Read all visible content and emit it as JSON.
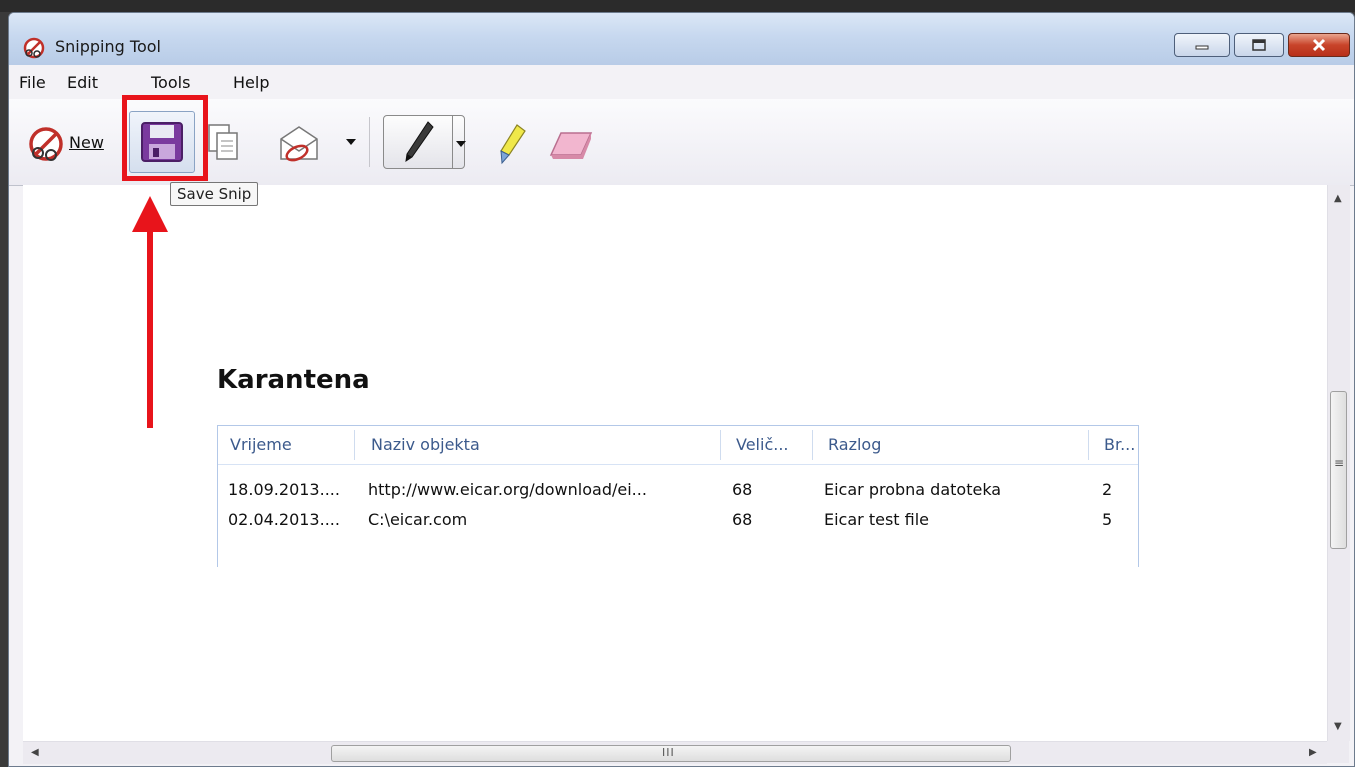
{
  "window": {
    "title": "Snipping Tool",
    "icon": "snipping-tool-scissors-icon"
  },
  "menu": [
    "File",
    "Edit",
    "Tools",
    "Help"
  ],
  "toolbar": {
    "new_label": "New",
    "icons": [
      "new-snip-icon",
      "save-snip-icon",
      "copy-icon",
      "send-snip-icon",
      "pen-icon",
      "highlighter-icon",
      "eraser-icon"
    ]
  },
  "tooltip": "Save Snip",
  "annotation": {
    "highlight_color": "#e8141b",
    "arrow_color": "#e8141b"
  },
  "snip": {
    "heading": "Karantena",
    "columns": [
      "Vrijeme",
      "Naziv objekta",
      "Velič...",
      "Razlog",
      "Br..."
    ],
    "rows": [
      [
        "18.09.2013....",
        "http://www.eicar.org/download/ei...",
        "68",
        "Eicar probna datoteka",
        "2"
      ],
      [
        "02.04.2013....",
        "C:\\eicar.com",
        "68",
        "Eicar test file",
        "5"
      ]
    ]
  },
  "scrollbar": {
    "h_thumb_grip": "III",
    "v_thumb_grip": "≡"
  }
}
